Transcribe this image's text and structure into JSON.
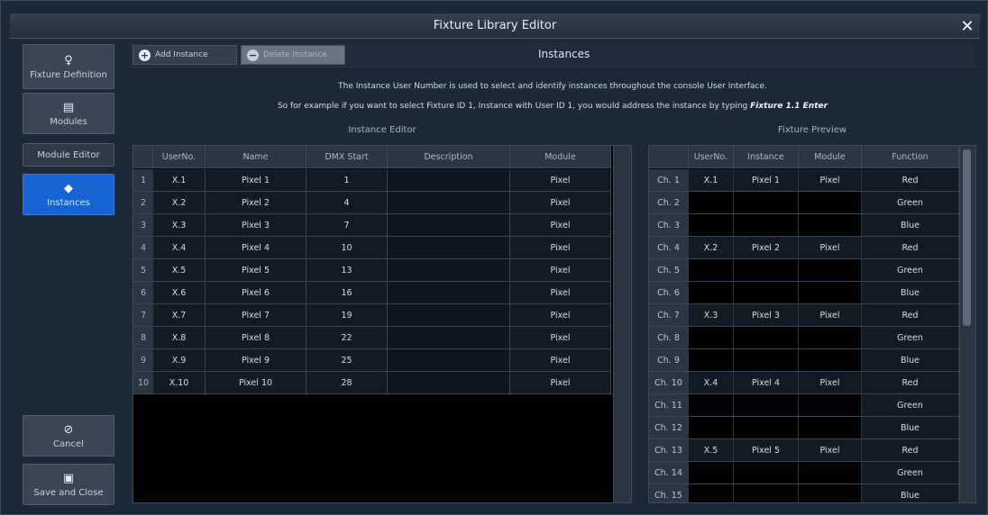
{
  "window": {
    "title": "Fixture Library Editor",
    "close_icon": "close-icon"
  },
  "sidebar": {
    "items": [
      {
        "label": "Fixture Definition",
        "icon": "lightbulb-icon"
      },
      {
        "label": "Modules",
        "icon": "document-icon"
      },
      {
        "label": "Module Editor",
        "icon": ""
      },
      {
        "label": "Instances",
        "icon": "cube-icon",
        "active": true
      }
    ],
    "cancel_label": "Cancel",
    "save_label": "Save and Close"
  },
  "toolbar": {
    "add_label": "Add Instance",
    "delete_label": "Delete Instance",
    "section_title": "Instances"
  },
  "info": {
    "line1": "The Instance User Number is used to select and identify instances throughout the console User Interface.",
    "line2_prefix": "So for example if you want to select Fixture ID 1, Instance with User ID 1, you would address the instance by typing ",
    "line2_emph": "Fixture 1.1 Enter"
  },
  "instance_editor": {
    "title": "Instance Editor",
    "columns": [
      "UserNo.",
      "Name",
      "DMX Start",
      "Description",
      "Module"
    ],
    "rows": [
      [
        "1",
        "X.1",
        "Pixel 1",
        "1",
        "",
        "Pixel"
      ],
      [
        "2",
        "X.2",
        "Pixel 2",
        "4",
        "",
        "Pixel"
      ],
      [
        "3",
        "X.3",
        "Pixel 3",
        "7",
        "",
        "Pixel"
      ],
      [
        "4",
        "X.4",
        "Pixel 4",
        "10",
        "",
        "Pixel"
      ],
      [
        "5",
        "X.5",
        "Pixel 5",
        "13",
        "",
        "Pixel"
      ],
      [
        "6",
        "X.6",
        "Pixel 6",
        "16",
        "",
        "Pixel"
      ],
      [
        "7",
        "X.7",
        "Pixel 7",
        "19",
        "",
        "Pixel"
      ],
      [
        "8",
        "X.8",
        "Pixel 8",
        "22",
        "",
        "Pixel"
      ],
      [
        "9",
        "X.9",
        "Pixel 9",
        "25",
        "",
        "Pixel"
      ],
      [
        "10",
        "X.10",
        "Pixel 10",
        "28",
        "",
        "Pixel"
      ]
    ]
  },
  "fixture_preview": {
    "title": "Fixture Preview",
    "columns": [
      "",
      "UserNo.",
      "Instance",
      "Module",
      "Function"
    ],
    "rows": [
      [
        "Ch. 1",
        "X.1",
        "Pixel 1",
        "Pixel",
        "Red"
      ],
      [
        "Ch. 2",
        "",
        "",
        "",
        "Green"
      ],
      [
        "Ch. 3",
        "",
        "",
        "",
        "Blue"
      ],
      [
        "Ch. 4",
        "X.2",
        "Pixel 2",
        "Pixel",
        "Red"
      ],
      [
        "Ch. 5",
        "",
        "",
        "",
        "Green"
      ],
      [
        "Ch. 6",
        "",
        "",
        "",
        "Blue"
      ],
      [
        "Ch. 7",
        "X.3",
        "Pixel 3",
        "Pixel",
        "Red"
      ],
      [
        "Ch. 8",
        "",
        "",
        "",
        "Green"
      ],
      [
        "Ch. 9",
        "",
        "",
        "",
        "Blue"
      ],
      [
        "Ch. 10",
        "X.4",
        "Pixel 4",
        "Pixel",
        "Red"
      ],
      [
        "Ch. 11",
        "",
        "",
        "",
        "Green"
      ],
      [
        "Ch. 12",
        "",
        "",
        "",
        "Blue"
      ],
      [
        "Ch. 13",
        "X.5",
        "Pixel 5",
        "Pixel",
        "Red"
      ],
      [
        "Ch. 14",
        "",
        "",
        "",
        "Green"
      ],
      [
        "Ch. 15",
        "",
        "",
        "",
        "Blue"
      ]
    ]
  }
}
